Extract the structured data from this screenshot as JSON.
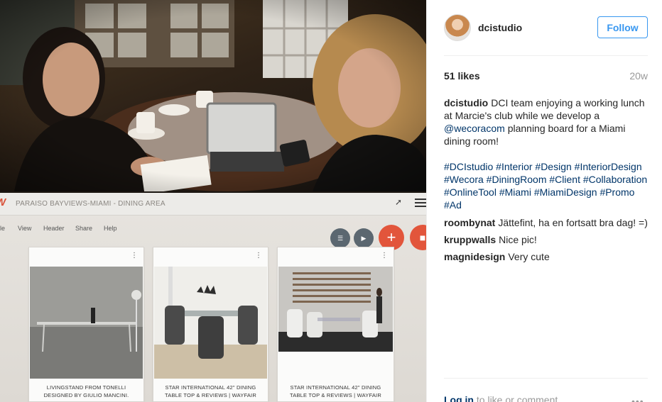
{
  "post": {
    "username": "dcistudio",
    "follow_label": "Follow",
    "likes": "51 likes",
    "age": "20w",
    "caption_user": "dcistudio",
    "caption_text_1": "DCI team enjoying a working lunch at Marcie's club while we develop a",
    "caption_mention": "@wecoracom",
    "caption_text_2": "planning board for a Miami dining room!",
    "hashtags": [
      "#DCIstudio",
      "#Interior",
      "#Design",
      "#InteriorDesign",
      "#Wecora",
      "#DiningRoom",
      "#Client",
      "#Collaboration",
      "#OnlineTool",
      "#Miami",
      "#MiamiDesign",
      "#Promo",
      "#Ad"
    ],
    "comments": [
      {
        "user": "roombynat",
        "text": "Jättefint, ha en fortsatt bra dag! =)"
      },
      {
        "user": "kruppwalls",
        "text": "Nice pic!"
      },
      {
        "user": "magnidesign",
        "text": "Very cute"
      }
    ],
    "login_link": "Log in",
    "login_rest": "to like or comment.",
    "more_icon": "more-icon"
  },
  "photo": {
    "board_title": "PARAISO BAYVIEWS-MIAMI - DINING AREA",
    "toolbar": [
      "le",
      "View",
      "Header",
      "Share",
      "Help"
    ],
    "cards": [
      {
        "caption": "LIVINGSTAND FROM TONELLI DESIGNED BY GIULIO MANCINI."
      },
      {
        "caption": "STAR INTERNATIONAL 42\" DINING TABLE TOP & REVIEWS | WAYFAIR"
      },
      {
        "caption": "STAR INTERNATIONAL 42\" DINING TABLE TOP & REVIEWS | WAYFAIR"
      }
    ]
  },
  "colors": {
    "link": "#003569",
    "follow": "#3897f0",
    "secondary": "#999999",
    "wecora_accent": "#e2553b"
  }
}
